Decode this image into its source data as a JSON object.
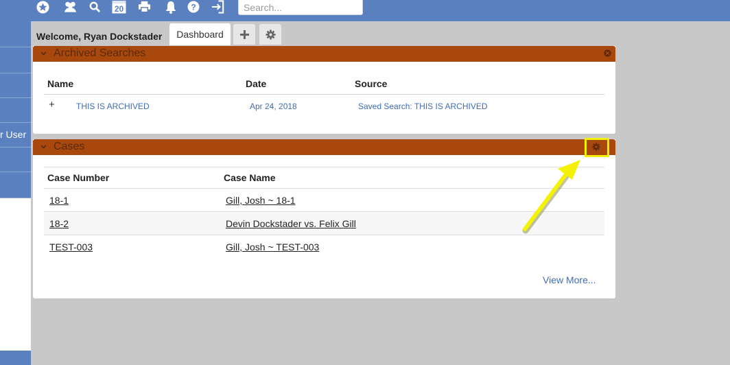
{
  "topbar": {
    "search_placeholder": "Search...",
    "calendar_day": "20",
    "icons": [
      "star-icon",
      "users-icon",
      "search-icon",
      "calendar-icon",
      "print-icon",
      "bell-icon",
      "help-icon",
      "logout-icon"
    ]
  },
  "sidebar": {
    "partial_label": "r User"
  },
  "header": {
    "welcome": "Welcome, Ryan Dockstader",
    "tab_dashboard": "Dashboard"
  },
  "archived": {
    "title": "Archived Searches",
    "columns": {
      "name": "Name",
      "date": "Date",
      "source": "Source"
    },
    "rows": [
      {
        "expand": "+",
        "name": "THIS IS ARCHIVED",
        "date": "Apr 24, 2018",
        "source": "Saved Search: THIS IS ARCHIVED"
      }
    ]
  },
  "cases": {
    "title": "Cases",
    "columns": {
      "number": "Case Number",
      "name": "Case Name"
    },
    "rows": [
      {
        "number": "18-1",
        "name": "Gill, Josh ~ 18-1"
      },
      {
        "number": "18-2",
        "name": "Devin Dockstader vs. Felix Gill"
      },
      {
        "number": "TEST-003",
        "name": "Gill, Josh ~ TEST-003"
      }
    ],
    "view_more": "View More..."
  },
  "colors": {
    "topbar": "#5b80c0",
    "panel_header": "#a8480c",
    "link": "#3e6db0",
    "highlight": "#f2ef00"
  }
}
